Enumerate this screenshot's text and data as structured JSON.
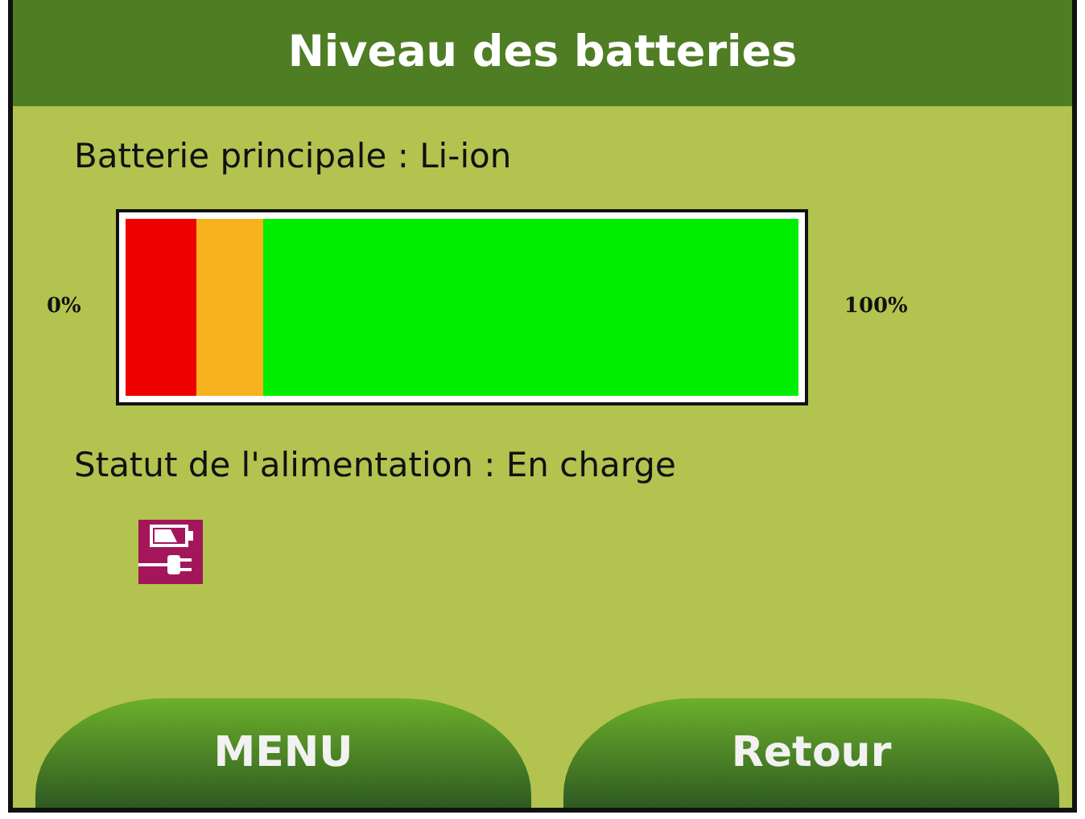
{
  "title": "Niveau des batteries",
  "battery": {
    "label": "Batterie principale : Li-ion",
    "min_label": "0%",
    "max_label": "100%",
    "level": 1,
    "zones": [
      {
        "color": "#ee0000"
      },
      {
        "color": "#f7b21e"
      },
      {
        "color": "#00ee00"
      }
    ]
  },
  "power_status": {
    "label": "Statut de l'alimentation : En charge",
    "charging": true
  },
  "buttons": [
    {
      "label": "MENU"
    },
    {
      "label": "Retour"
    }
  ]
}
